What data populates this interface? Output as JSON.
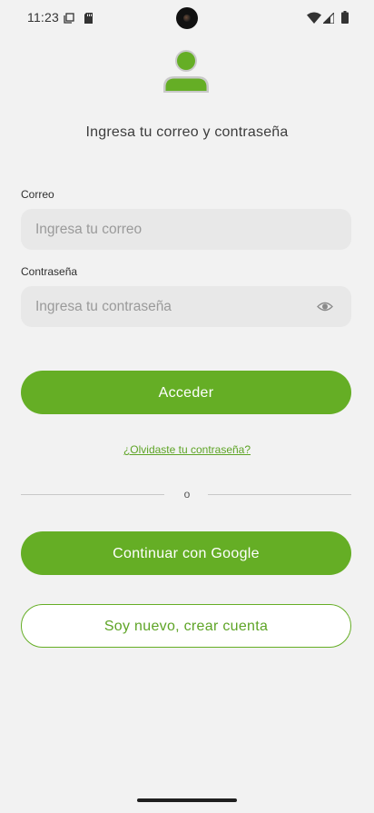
{
  "status_bar": {
    "time": "11:23"
  },
  "login": {
    "heading": "Ingresa tu correo y contraseña",
    "email": {
      "label": "Correo",
      "value": "",
      "placeholder": "Ingresa tu correo"
    },
    "password": {
      "label": "Contraseña",
      "value": "",
      "placeholder": "Ingresa tu contraseña"
    },
    "login_button_label": "Acceder",
    "forgot_password_label": "¿Olvidaste tu contraseña?",
    "divider_text": "o",
    "google_button_label": "Continuar con Google",
    "register_button_label": "Soy nuevo, crear cuenta"
  },
  "icons": {
    "avatar": "user-avatar-icon",
    "password_toggle": "eye-icon",
    "status": [
      "copy-icon",
      "sd-card-icon",
      "wifi-icon",
      "signal-icon",
      "battery-icon"
    ]
  },
  "colors": {
    "accent": "#65ae25",
    "accent_text": "#5ea426",
    "background": "#f2f2f2",
    "input_bg": "#e8e8e8",
    "avatar_gray": "#c9c9c9"
  }
}
